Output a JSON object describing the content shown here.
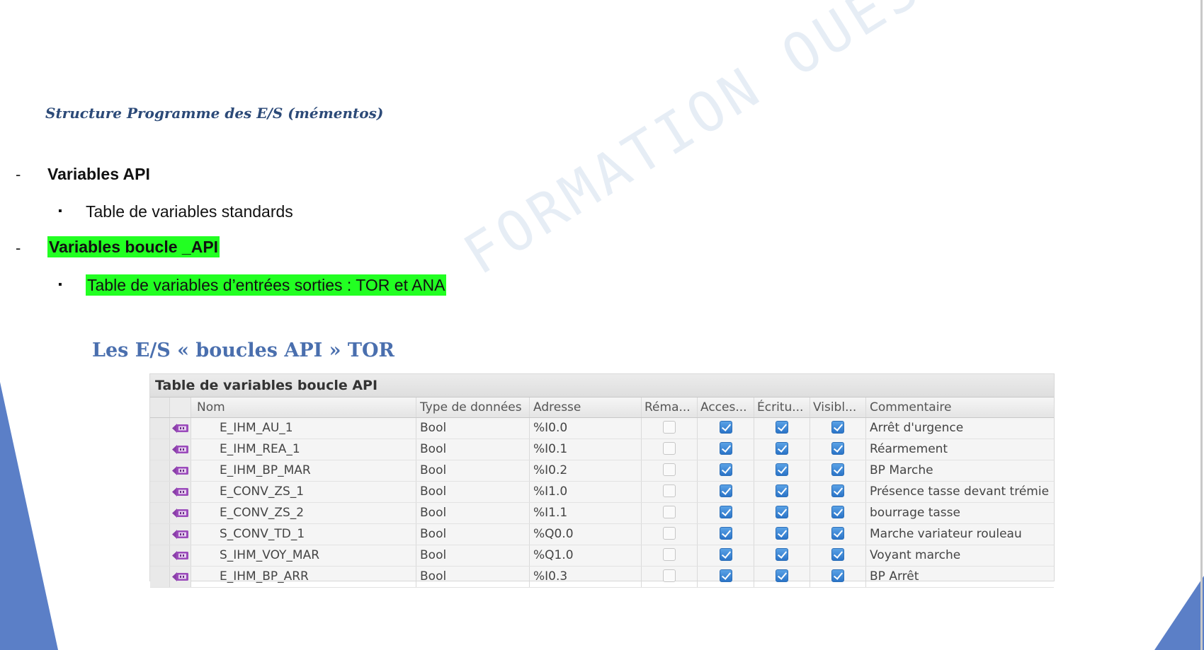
{
  "slide": {
    "title": "Structure Programme des E/S  (mémentos)",
    "watermark": "FORMATION OUEST",
    "bullets": [
      {
        "marker": "-",
        "text": "Variables API",
        "bold": true,
        "highlight": false
      },
      {
        "marker": "▪",
        "text": "Table de variables standards",
        "bold": false,
        "highlight": false
      },
      {
        "marker": "-",
        "text": "Variables boucle _API",
        "bold": true,
        "highlight": true
      },
      {
        "marker": "▪",
        "text": "Table de variables d’entrées sorties : TOR et ANA",
        "bold": false,
        "highlight": true
      }
    ],
    "subheading": "Les E/S « boucles API » TOR",
    "highlight_color": "#22ff22",
    "accent_color": "#5b7fc7"
  },
  "table": {
    "title": "Table de variables boucle API",
    "headers": [
      "Nom",
      "Type de données",
      "Adresse",
      "Réma...",
      "Acces...",
      "Écritu...",
      "Visibl...",
      "Commentaire"
    ],
    "icon": "plc-tag-icon",
    "rows": [
      {
        "name": "E_IHM_AU_1",
        "type": "Bool",
        "address": "%I0.0",
        "retain": false,
        "accessible": true,
        "writable": true,
        "visible": true,
        "comment": "Arrêt d'urgence"
      },
      {
        "name": "E_IHM_REA_1",
        "type": "Bool",
        "address": "%I0.1",
        "retain": false,
        "accessible": true,
        "writable": true,
        "visible": true,
        "comment": "Réarmement"
      },
      {
        "name": "E_IHM_BP_MAR",
        "type": "Bool",
        "address": "%I0.2",
        "retain": false,
        "accessible": true,
        "writable": true,
        "visible": true,
        "comment": "BP Marche"
      },
      {
        "name": "E_CONV_ZS_1",
        "type": "Bool",
        "address": "%I1.0",
        "retain": false,
        "accessible": true,
        "writable": true,
        "visible": true,
        "comment": "Présence tasse devant trémie"
      },
      {
        "name": "E_CONV_ZS_2",
        "type": "Bool",
        "address": "%I1.1",
        "retain": false,
        "accessible": true,
        "writable": true,
        "visible": true,
        "comment": "bourrage tasse"
      },
      {
        "name": "S_CONV_TD_1",
        "type": "Bool",
        "address": "%Q0.0",
        "retain": false,
        "accessible": true,
        "writable": true,
        "visible": true,
        "comment": "Marche variateur rouleau"
      },
      {
        "name": "S_IHM_VOY_MAR",
        "type": "Bool",
        "address": "%Q1.0",
        "retain": false,
        "accessible": true,
        "writable": true,
        "visible": true,
        "comment": "Voyant marche"
      },
      {
        "name": "E_IHM_BP_ARR",
        "type": "Bool",
        "address": "%I0.3",
        "retain": false,
        "accessible": true,
        "writable": true,
        "visible": true,
        "comment": "BP Arrêt"
      }
    ]
  }
}
